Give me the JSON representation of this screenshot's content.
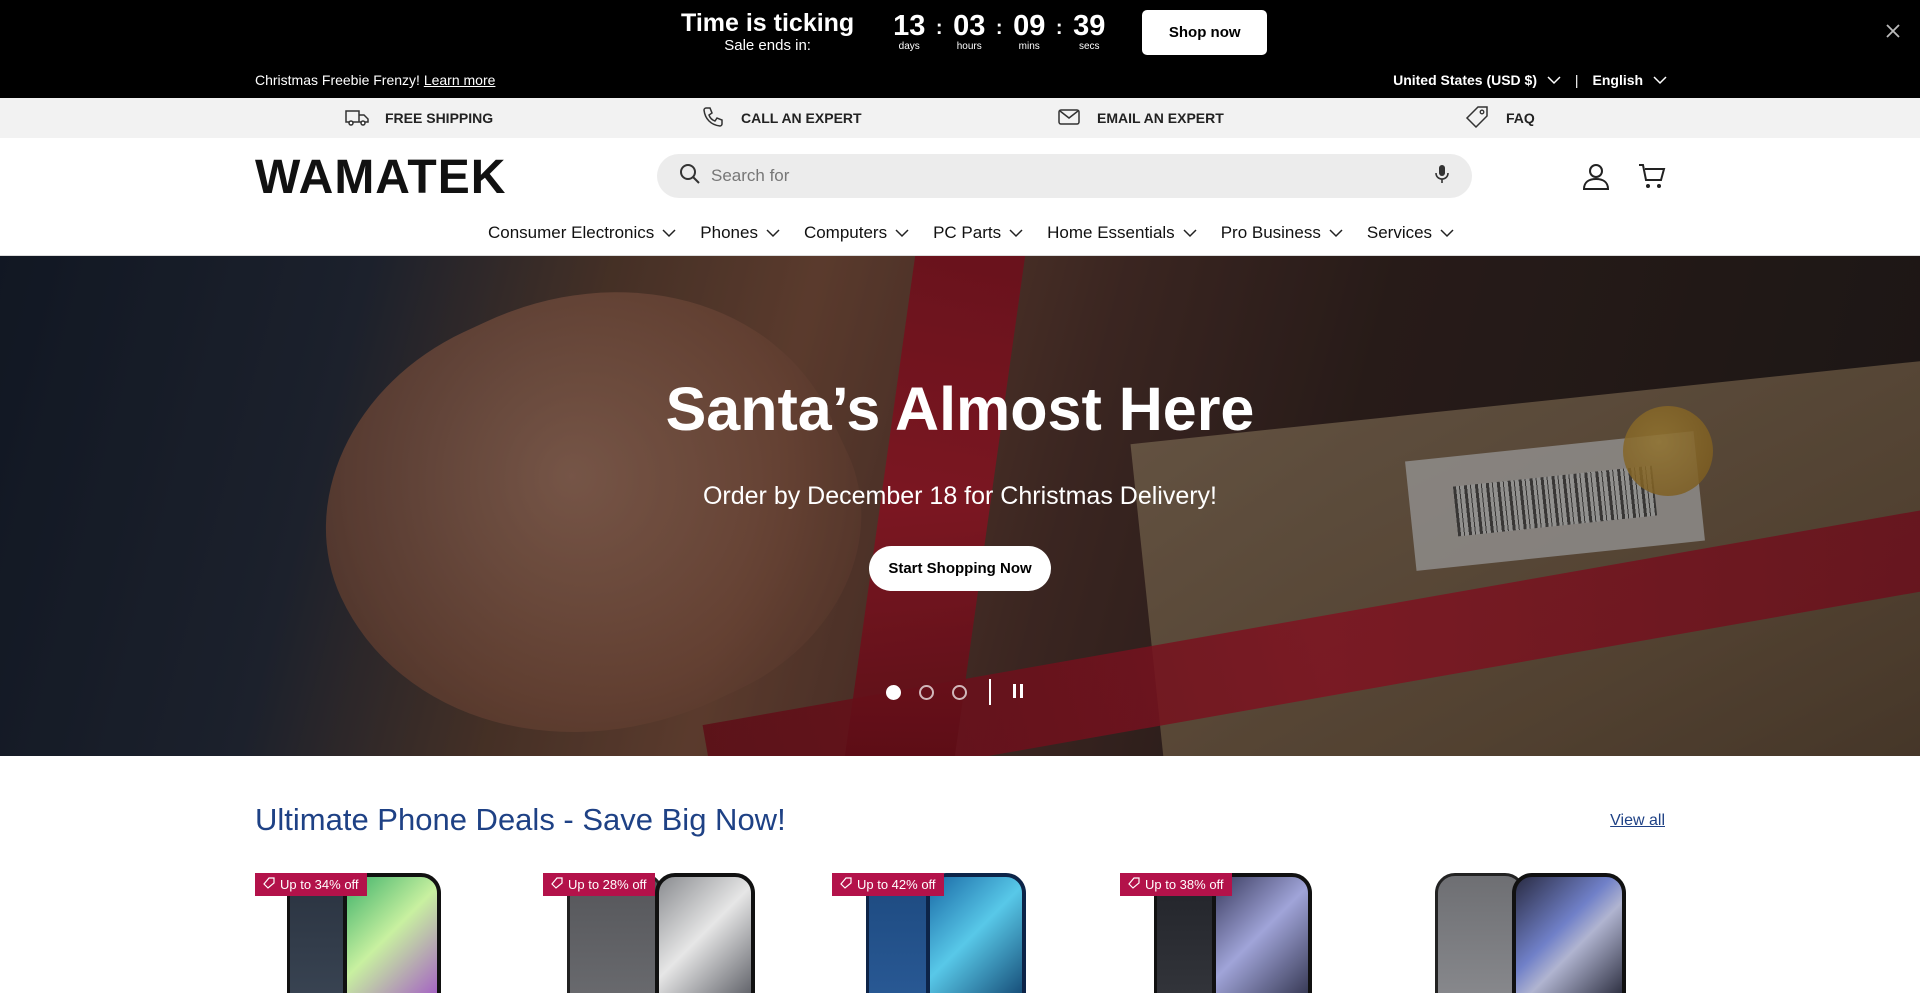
{
  "countdown": {
    "title": "Time is ticking",
    "subtitle": "Sale ends in:",
    "units": [
      {
        "value": "13",
        "label": "days"
      },
      {
        "value": "03",
        "label": "hours"
      },
      {
        "value": "09",
        "label": "mins"
      },
      {
        "value": "39",
        "label": "secs"
      }
    ],
    "separator": ":",
    "shop_now_label": "Shop now"
  },
  "announcement": {
    "text": "Christmas Freebie Frenzy!",
    "link_label": "Learn more",
    "country": "United States (USD $)",
    "language": "English",
    "divider": "|"
  },
  "info_bar": {
    "items": [
      {
        "icon": "truck-icon",
        "label": "FREE SHIPPING"
      },
      {
        "icon": "phone-icon",
        "label": "CALL AN EXPERT"
      },
      {
        "icon": "mail-icon",
        "label": "EMAIL AN EXPERT"
      },
      {
        "icon": "tag-icon",
        "label": "FAQ"
      }
    ]
  },
  "header": {
    "logo_text": "WAMATEK",
    "search_placeholder": "Search for"
  },
  "nav": {
    "items": [
      "Consumer Electronics",
      "Phones",
      "Computers",
      "PC Parts",
      "Home Essentials",
      "Pro Business",
      "Services"
    ]
  },
  "hero": {
    "title": "Santa’s Almost Here",
    "subtitle": "Order by December 18 for Christmas Delivery!",
    "cta_label": "Start Shopping Now",
    "slide_count": 3,
    "active_slide": 1
  },
  "deals": {
    "title": "Ultimate Phone Deals - Save Big Now!",
    "view_all_label": "View all",
    "products": [
      {
        "badge": "Up to 34% off"
      },
      {
        "badge": "Up to 28% off"
      },
      {
        "badge": "Up to 42% off"
      },
      {
        "badge": "Up to 38% off"
      },
      {
        "badge": ""
      }
    ]
  },
  "colors": {
    "accent": "#1e4185",
    "badge": "#b3124a",
    "topbar": "#000000"
  }
}
